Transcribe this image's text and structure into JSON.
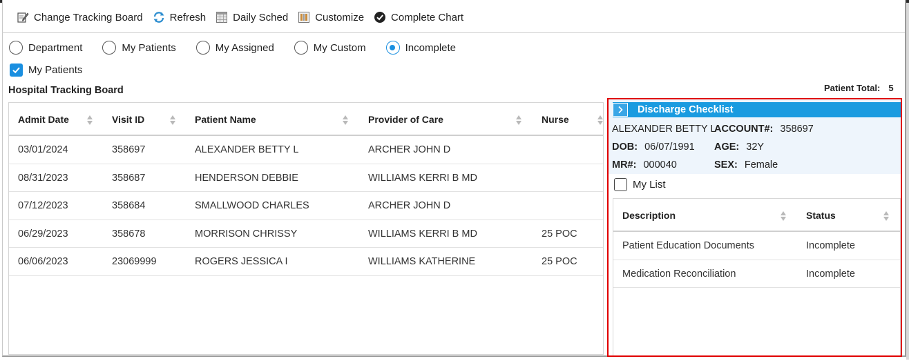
{
  "toolbar": {
    "change_tracking_board": "Change Tracking Board",
    "refresh": "Refresh",
    "daily_sched": "Daily Sched",
    "customize": "Customize",
    "complete_chart": "Complete Chart"
  },
  "filters": {
    "radios": [
      {
        "label": "Department",
        "selected": false
      },
      {
        "label": "My Patients",
        "selected": false
      },
      {
        "label": "My Assigned",
        "selected": false
      },
      {
        "label": "My Custom",
        "selected": false
      },
      {
        "label": "Incomplete",
        "selected": true
      }
    ],
    "my_patients_checkbox": {
      "label": "My Patients",
      "checked": true
    }
  },
  "board": {
    "title": "Hospital Tracking Board",
    "patient_total_label": "Patient Total:",
    "patient_total": "5",
    "columns": [
      "Admit Date",
      "Visit ID",
      "Patient Name",
      "Provider of Care",
      "Nurse"
    ],
    "rows": [
      {
        "admit_date": "03/01/2024",
        "visit_id": "358697",
        "patient_name": "ALEXANDER BETTY L",
        "provider": "ARCHER JOHN D",
        "nurse": ""
      },
      {
        "admit_date": "08/31/2023",
        "visit_id": "358687",
        "patient_name": "HENDERSON DEBBIE",
        "provider": "WILLIAMS KERRI B MD",
        "nurse": ""
      },
      {
        "admit_date": "07/12/2023",
        "visit_id": "358684",
        "patient_name": "SMALLWOOD CHARLES",
        "provider": "ARCHER JOHN D",
        "nurse": ""
      },
      {
        "admit_date": "06/29/2023",
        "visit_id": "358678",
        "patient_name": "MORRISON CHRISSY",
        "provider": "WILLIAMS KERRI B MD",
        "nurse": "25 POC"
      },
      {
        "admit_date": "06/06/2023",
        "visit_id": "23069999",
        "patient_name": "ROGERS JESSICA I",
        "provider": "WILLIAMS KATHERINE",
        "nurse": "25 POC"
      }
    ]
  },
  "discharge": {
    "title": "Discharge Checklist",
    "patient_name": "ALEXANDER BETTY L",
    "account_label": "ACCOUNT#:",
    "account": "358697",
    "dob_label": "DOB:",
    "dob": "06/07/1991",
    "age_label": "AGE:",
    "age": "32Y",
    "mr_label": "MR#:",
    "mr": "000040",
    "sex_label": "SEX:",
    "sex": "Female",
    "my_list": {
      "label": "My List",
      "checked": false
    },
    "columns": [
      "Description",
      "Status"
    ],
    "rows": [
      {
        "description": "Patient Education Documents",
        "status": "Incomplete"
      },
      {
        "description": "Medication Reconciliation",
        "status": "Incomplete"
      }
    ]
  },
  "colors": {
    "accent": "#1a8fe0",
    "header_bar": "#1a9be0",
    "highlight_border": "#e00000",
    "info_bg": "#eef5fc"
  }
}
